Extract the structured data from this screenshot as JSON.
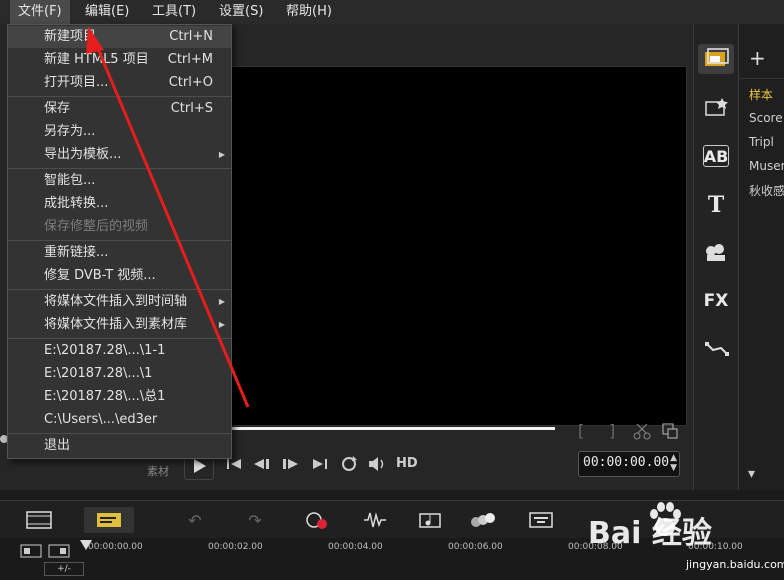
{
  "menubar": {
    "items": [
      "文件(F)",
      "编辑(E)",
      "工具(T)",
      "设置(S)",
      "帮助(H)"
    ]
  },
  "file_menu": {
    "groups": [
      [
        {
          "label": "新建项目",
          "shortcut": "Ctrl+N"
        },
        {
          "label": "新建 HTML5 项目",
          "shortcut": "Ctrl+M"
        },
        {
          "label": "打开项目...",
          "shortcut": "Ctrl+O"
        }
      ],
      [
        {
          "label": "保存",
          "shortcut": "Ctrl+S"
        },
        {
          "label": "另存为...",
          "shortcut": ""
        },
        {
          "label": "导出为模板...",
          "shortcut": "",
          "submenu": true
        }
      ],
      [
        {
          "label": "智能包...",
          "shortcut": ""
        },
        {
          "label": "成批转换...",
          "shortcut": ""
        },
        {
          "label": "保存修整后的视频",
          "shortcut": "",
          "disabled": true
        }
      ],
      [
        {
          "label": "重新链接...",
          "shortcut": ""
        },
        {
          "label": "修复 DVB-T 视频...",
          "shortcut": ""
        }
      ],
      [
        {
          "label": "将媒体文件插入到时间轴",
          "shortcut": "",
          "submenu": true
        },
        {
          "label": "将媒体文件插入到素材库",
          "shortcut": "",
          "submenu": true
        }
      ],
      [
        {
          "label": "E:\\20187.28\\...\\1-1",
          "shortcut": ""
        },
        {
          "label": "E:\\20187.28\\...\\1",
          "shortcut": ""
        },
        {
          "label": "E:\\20187.28\\...\\总1",
          "shortcut": ""
        },
        {
          "label": "C:\\Users\\...\\ed3er",
          "shortcut": ""
        }
      ],
      [
        {
          "label": "退出",
          "shortcut": ""
        }
      ]
    ]
  },
  "player": {
    "timecode": "00:00:00.00",
    "hd_label": "HD",
    "clip_label": "素材"
  },
  "side_toolbar": {
    "icons": [
      "media-icon",
      "instant-project-icon",
      "transition-icon",
      "title-icon",
      "graphic-icon",
      "filter-icon",
      "path-icon"
    ],
    "labels": {
      "transition": "AB",
      "title": "T",
      "filter": "FX"
    }
  },
  "library": {
    "add_symbol": "+",
    "items": [
      {
        "label": "样本",
        "highlight": true
      },
      {
        "label": "Score",
        "highlight": false
      },
      {
        "label": "Tripl",
        "highlight": false
      },
      {
        "label": "Muser",
        "highlight": false
      },
      {
        "label": "秋收感",
        "highlight": false
      }
    ]
  },
  "timeline": {
    "ticks": [
      "00:00:00.00",
      "00:00:02.00",
      "00:00:04.00",
      "00:00:06.00",
      "00:00:08.00",
      "00:00:10.00"
    ],
    "zoom_label": "+/-"
  },
  "watermark": {
    "text": "Bai 经验",
    "url": "jingyan.baidu.com"
  },
  "colors": {
    "accent": "#f3c740",
    "arrow": "#e51d1d"
  }
}
